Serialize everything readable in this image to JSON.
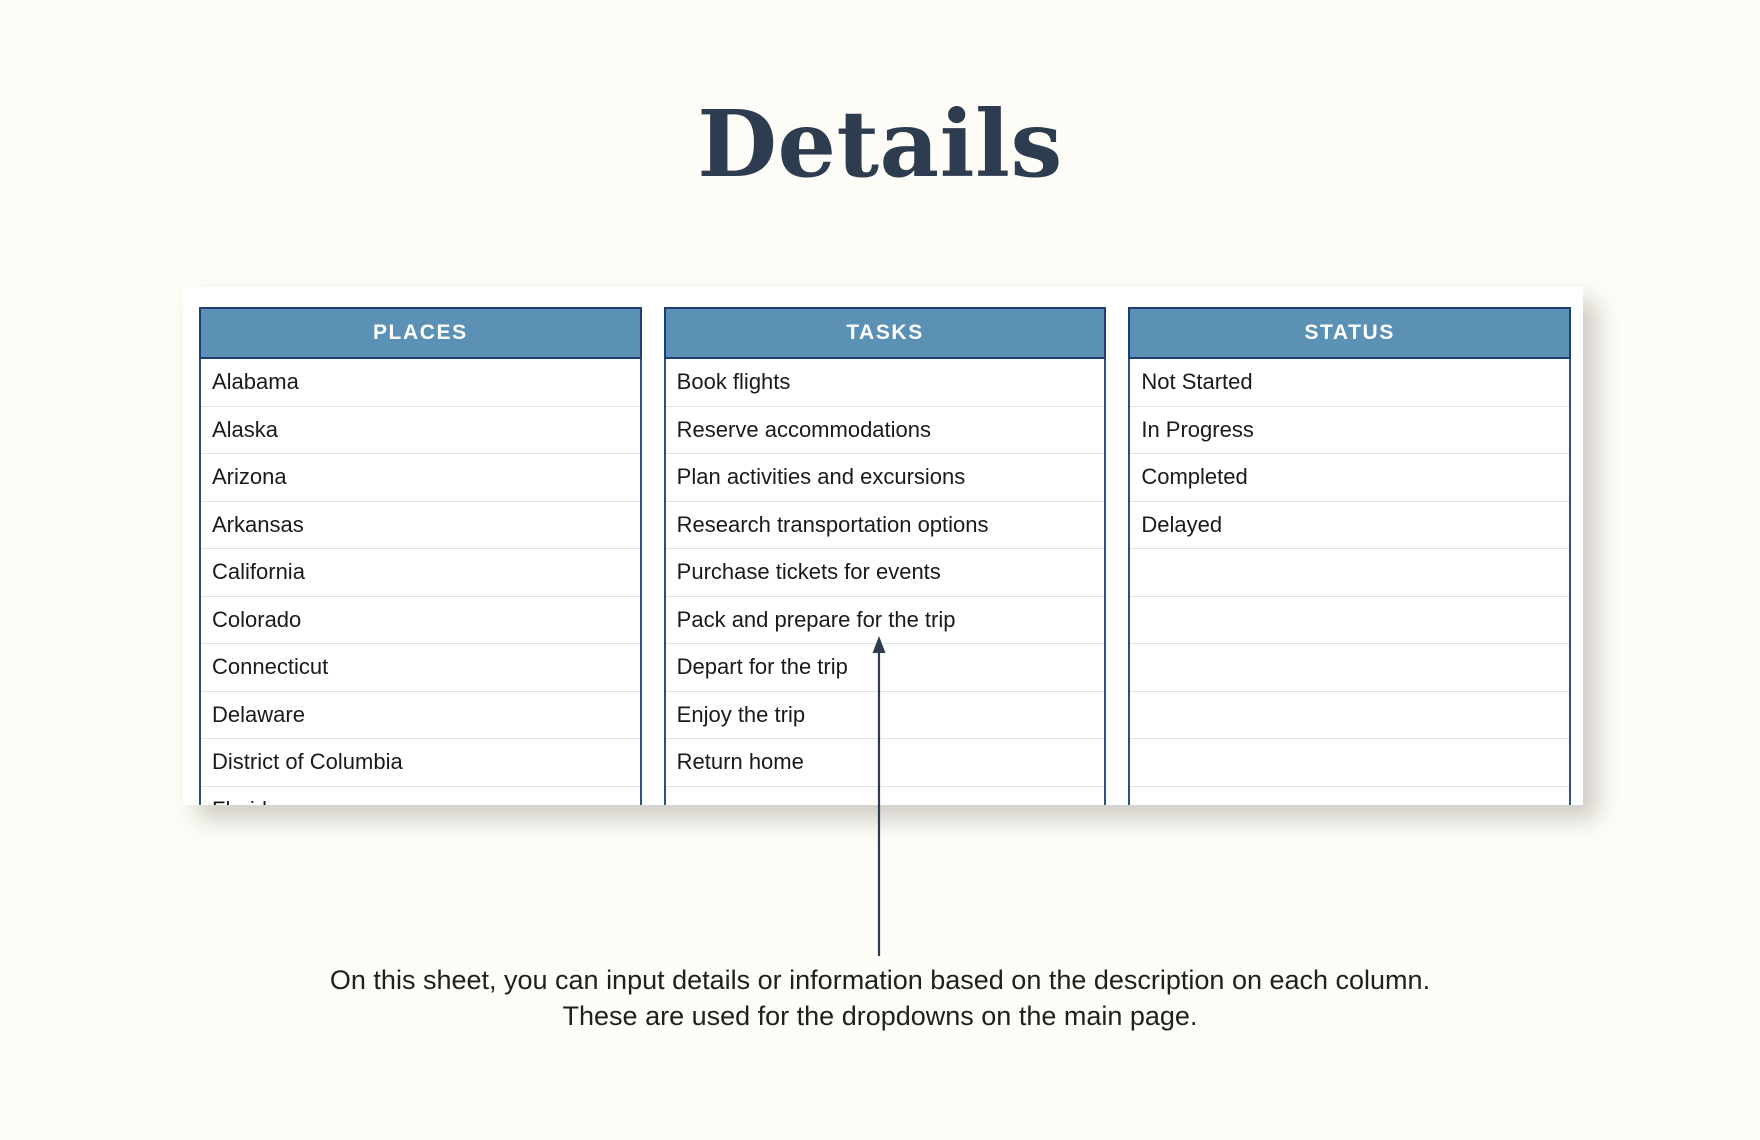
{
  "page": {
    "title": "Details",
    "background_color": "#fdfcf6",
    "title_color": "#2e3c4f"
  },
  "theme": {
    "header_fill": "#5b91b5",
    "header_border": "#1f3f73",
    "column_border": "#2c4f86",
    "row_divider": "#e2e2e2",
    "card_background": "#ffffff",
    "arrow_color": "#2e3c4f",
    "text_color": "#1a1a1a"
  },
  "table": {
    "columns": [
      {
        "header": "PLACES",
        "cells": [
          "Alabama",
          "Alaska",
          "Arizona",
          "Arkansas",
          "California",
          "Colorado",
          "Connecticut",
          "Delaware",
          "District of Columbia",
          "Florida"
        ]
      },
      {
        "header": "TASKS",
        "cells": [
          "Book flights",
          "Reserve accommodations",
          "Plan activities and excursions",
          "Research transportation options",
          "Purchase tickets for events",
          "Pack and prepare for the trip",
          "Depart for the trip",
          "Enjoy the trip",
          "Return home",
          ""
        ]
      },
      {
        "header": "STATUS",
        "cells": [
          "Not Started",
          "In Progress",
          "Completed",
          "Delayed",
          "",
          "",
          "",
          "",
          "",
          ""
        ]
      }
    ]
  },
  "annotation": {
    "icon": "arrow-up-icon",
    "caption_line_1": "On this sheet, you can input details or information based on the description on each column.",
    "caption_line_2": "These are used for the dropdowns on the main page."
  }
}
